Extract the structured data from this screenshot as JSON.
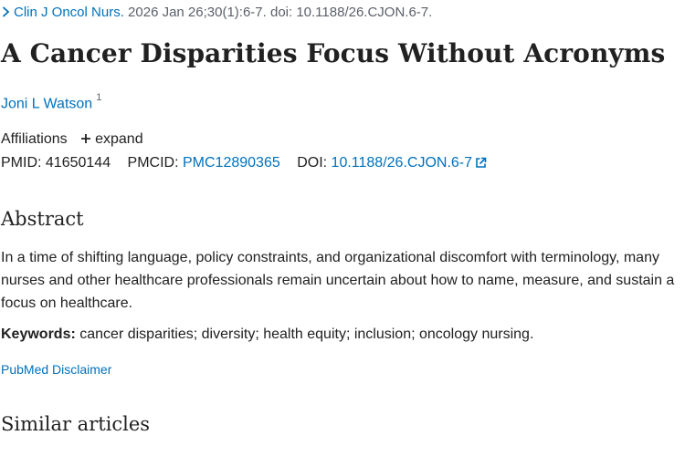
{
  "citation": {
    "journal": "Clin J Oncol Nurs.",
    "details": " 2026 Jan 26;30(1):6-7. doi: 10.1188/26.CJON.6-7."
  },
  "article": {
    "title": "A Cancer Disparities Focus Without Acronyms",
    "authors": [
      {
        "name": "Joni L Watson",
        "affiliation_ref": "1"
      }
    ]
  },
  "affiliations": {
    "label": "Affiliations",
    "expand_label": "expand"
  },
  "identifiers": {
    "pmid_label": "PMID:",
    "pmid": "41650144",
    "pmcid_label": "PMCID:",
    "pmcid": "PMC12890365",
    "doi_label": "DOI:",
    "doi": "10.1188/26.CJON.6-7"
  },
  "abstract": {
    "heading": "Abstract",
    "text": "In a time of shifting language, policy constraints, and organizational discomfort with terminology, many nurses and other healthcare professionals remain uncertain about how to name, measure, and sustain a focus on healthcare.",
    "keywords_label": "Keywords:",
    "keywords": " cancer disparities; diversity; health equity; inclusion; oncology nursing."
  },
  "disclaimer": {
    "label": "PubMed Disclaimer"
  },
  "similar": {
    "heading": "Similar articles"
  },
  "icons": {
    "breadcrumb": "chevron-right-icon",
    "expand": "plus-icon",
    "external": "external-link-icon"
  },
  "colors": {
    "link": "#0071bc",
    "text": "#212121",
    "muted": "#5b616b"
  }
}
